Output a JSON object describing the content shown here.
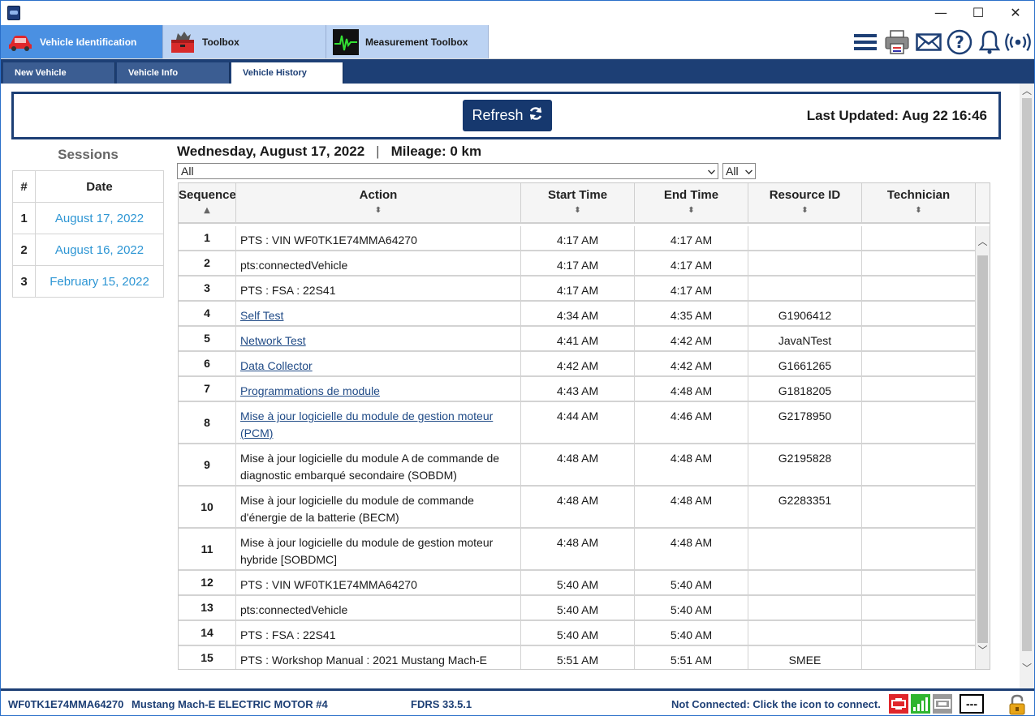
{
  "window": {
    "minimize": "—",
    "maximize": "☐",
    "close": "✕"
  },
  "main_tabs": [
    {
      "label": "Vehicle Identification",
      "icon": "car-icon",
      "active": true
    },
    {
      "label": "Toolbox",
      "icon": "toolbox-icon",
      "active": false
    },
    {
      "label": "Measurement Toolbox",
      "icon": "oscilloscope-icon",
      "active": false
    }
  ],
  "toolbar_icons": [
    "menu-icon",
    "printer-icon",
    "mail-icon",
    "help-icon",
    "bell-icon",
    "wireless-icon"
  ],
  "sub_tabs": [
    {
      "label": "New Vehicle",
      "active": false
    },
    {
      "label": "Vehicle Info",
      "active": false
    },
    {
      "label": "Vehicle History",
      "active": true
    }
  ],
  "refresh": {
    "label": "Refresh",
    "last_updated": "Last Updated: Aug 22 16:46"
  },
  "sessions": {
    "title": "Sessions",
    "col_num": "#",
    "col_date": "Date",
    "items": [
      {
        "num": "1",
        "date": "August 17, 2022"
      },
      {
        "num": "2",
        "date": "August 16, 2022"
      },
      {
        "num": "3",
        "date": "February 15, 2022"
      }
    ]
  },
  "session_detail": {
    "date": "Wednesday, August 17, 2022",
    "separator": "|",
    "mileage": "Mileage: 0 km",
    "filter_action": "All",
    "filter_type": "All"
  },
  "table": {
    "columns": [
      "Sequence",
      "Action",
      "Start Time",
      "End Time",
      "Resource ID",
      "Technician"
    ],
    "rows": [
      {
        "seq": "1",
        "action": "PTS : VIN WF0TK1E74MMA64270",
        "link": false,
        "start": "4:17 AM",
        "end": "4:17 AM",
        "rid": "",
        "tech": "",
        "h": 31
      },
      {
        "seq": "2",
        "action": "pts:connectedVehicle",
        "link": false,
        "start": "4:17 AM",
        "end": "4:17 AM",
        "rid": "",
        "tech": "",
        "h": 31
      },
      {
        "seq": "3",
        "action": "PTS : FSA : 22S41",
        "link": false,
        "start": "4:17 AM",
        "end": "4:17 AM",
        "rid": "",
        "tech": "",
        "h": 31
      },
      {
        "seq": "4",
        "action": "Self Test",
        "link": true,
        "start": "4:34 AM",
        "end": "4:35 AM",
        "rid": "G1906412",
        "tech": "",
        "h": 31
      },
      {
        "seq": "5",
        "action": "Network Test",
        "link": true,
        "start": "4:41 AM",
        "end": "4:42 AM",
        "rid": "JavaNTest",
        "tech": "",
        "h": 31
      },
      {
        "seq": "6",
        "action": "Data Collector",
        "link": true,
        "start": "4:42 AM",
        "end": "4:42 AM",
        "rid": "G1661265",
        "tech": "",
        "h": 31
      },
      {
        "seq": "7",
        "action": "Programmations de module",
        "link": true,
        "start": "4:43 AM",
        "end": "4:48 AM",
        "rid": "G1818205",
        "tech": "",
        "h": 31
      },
      {
        "seq": "8",
        "action": "Mise à jour logicielle du module de gestion moteur (PCM)",
        "link": true,
        "start": "4:44 AM",
        "end": "4:46 AM",
        "rid": "G2178950",
        "tech": "",
        "h": 52
      },
      {
        "seq": "9",
        "action": "Mise à jour logicielle du module A de commande de diagnostic embarqué secondaire (SOBDM)",
        "link": false,
        "start": "4:48 AM",
        "end": "4:48 AM",
        "rid": "G2195828",
        "tech": "",
        "h": 52
      },
      {
        "seq": "10",
        "action": "Mise à jour logicielle du module de commande d'énergie de la batterie (BECM)",
        "link": false,
        "start": "4:48 AM",
        "end": "4:48 AM",
        "rid": "G2283351",
        "tech": "",
        "h": 52
      },
      {
        "seq": "11",
        "action": "Mise à jour logicielle du module de gestion moteur hybride [SOBDMC]",
        "link": false,
        "start": "4:48 AM",
        "end": "4:48 AM",
        "rid": "",
        "tech": "",
        "h": 52
      },
      {
        "seq": "12",
        "action": "PTS : VIN WF0TK1E74MMA64270",
        "link": false,
        "start": "5:40 AM",
        "end": "5:40 AM",
        "rid": "",
        "tech": "",
        "h": 31
      },
      {
        "seq": "13",
        "action": "pts:connectedVehicle",
        "link": false,
        "start": "5:40 AM",
        "end": "5:40 AM",
        "rid": "",
        "tech": "",
        "h": 31
      },
      {
        "seq": "14",
        "action": "PTS : FSA : 22S41",
        "link": false,
        "start": "5:40 AM",
        "end": "5:40 AM",
        "rid": "",
        "tech": "",
        "h": 31
      },
      {
        "seq": "15",
        "action": "PTS : Workshop Manual : 2021 Mustang Mach-E",
        "link": false,
        "start": "5:51 AM",
        "end": "5:51 AM",
        "rid": "SMEE",
        "tech": "",
        "h": 31
      }
    ]
  },
  "status": {
    "vin": "WF0TK1E74MMA64270",
    "vehicle": "Mustang Mach-E ELECTRIC MOTOR #4",
    "version": "FDRS 33.5.1",
    "connection": "Not Connected: Click the icon to connect.",
    "indicator": "---",
    "colors": {
      "alert_red": "#e0262b",
      "signal_green": "#2fb52f",
      "brand_blue": "#1d3f75"
    }
  }
}
